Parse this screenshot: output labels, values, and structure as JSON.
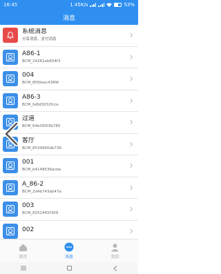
{
  "status_bar": {
    "time": "16:45",
    "speed": "1.45K/s",
    "battery": "53%"
  },
  "header": {
    "title": "消息"
  },
  "colors": {
    "primary": "#2e8ff0",
    "alert_icon": "#e84a4a",
    "device_icon": "#3b8fe8"
  },
  "messages": [
    {
      "title": "系统消息",
      "subtitle": "分享消息，支付消息",
      "icon": "bell-icon"
    },
    {
      "title": "A86-1",
      "subtitle": "BCM_24261eb654f3",
      "icon": "device-icon"
    },
    {
      "title": "004",
      "subtitle": "BCM_8f00eec4389f",
      "icon": "device-icon"
    },
    {
      "title": "A86-3",
      "subtitle": "BCM_fe8d3032fcce",
      "icon": "device-icon"
    },
    {
      "title": "过道",
      "subtitle": "BCM_64bf3003b785",
      "icon": "device-icon"
    },
    {
      "title": "客厅",
      "subtitle": "BCM_8534900db736",
      "icon": "device-icon"
    },
    {
      "title": "001",
      "subtitle": "BCM_b4148536acbe",
      "icon": "device-icon"
    },
    {
      "title": "A_86-2",
      "subtitle": "BCM_2d4b743ab47a",
      "icon": "device-icon"
    },
    {
      "title": "003",
      "subtitle": "BCM_82524ff2f309",
      "icon": "device-icon"
    },
    {
      "title": "002",
      "subtitle": "",
      "icon": "device-icon"
    }
  ],
  "tabs": [
    {
      "label": "首页",
      "icon": "home-icon",
      "active": false
    },
    {
      "label": "消息",
      "icon": "message-icon",
      "active": true
    },
    {
      "label": "我的",
      "icon": "profile-icon",
      "active": false
    }
  ],
  "system_nav": [
    "menu-icon",
    "home-square-icon",
    "back-icon"
  ]
}
